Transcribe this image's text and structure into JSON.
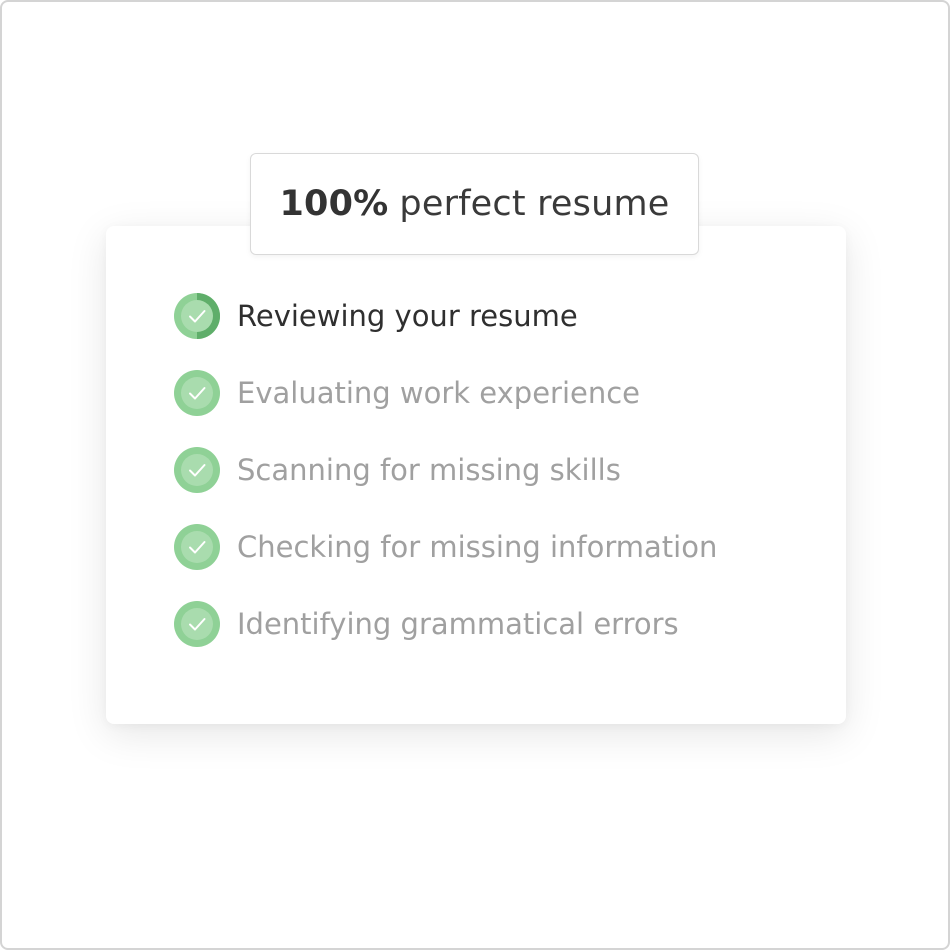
{
  "score": {
    "percent": "100%",
    "label": "perfect resume"
  },
  "checklist": {
    "items": [
      {
        "label": "Reviewing your resume",
        "status": "active",
        "icon": "check-circle-progress-icon"
      },
      {
        "label": "Evaluating work experience",
        "status": "done",
        "icon": "check-circle-icon"
      },
      {
        "label": "Scanning for missing skills",
        "status": "done",
        "icon": "check-circle-icon"
      },
      {
        "label": "Checking for missing information",
        "status": "done",
        "icon": "check-circle-icon"
      },
      {
        "label": "Identifying grammatical errors",
        "status": "done",
        "icon": "check-circle-icon"
      }
    ]
  },
  "colors": {
    "check_green": "#8fd196",
    "check_green_inner": "#a9dcae",
    "check_green_dark": "#5fae6a",
    "active_text": "#2f2f2f",
    "done_text": "#a0a0a0"
  }
}
